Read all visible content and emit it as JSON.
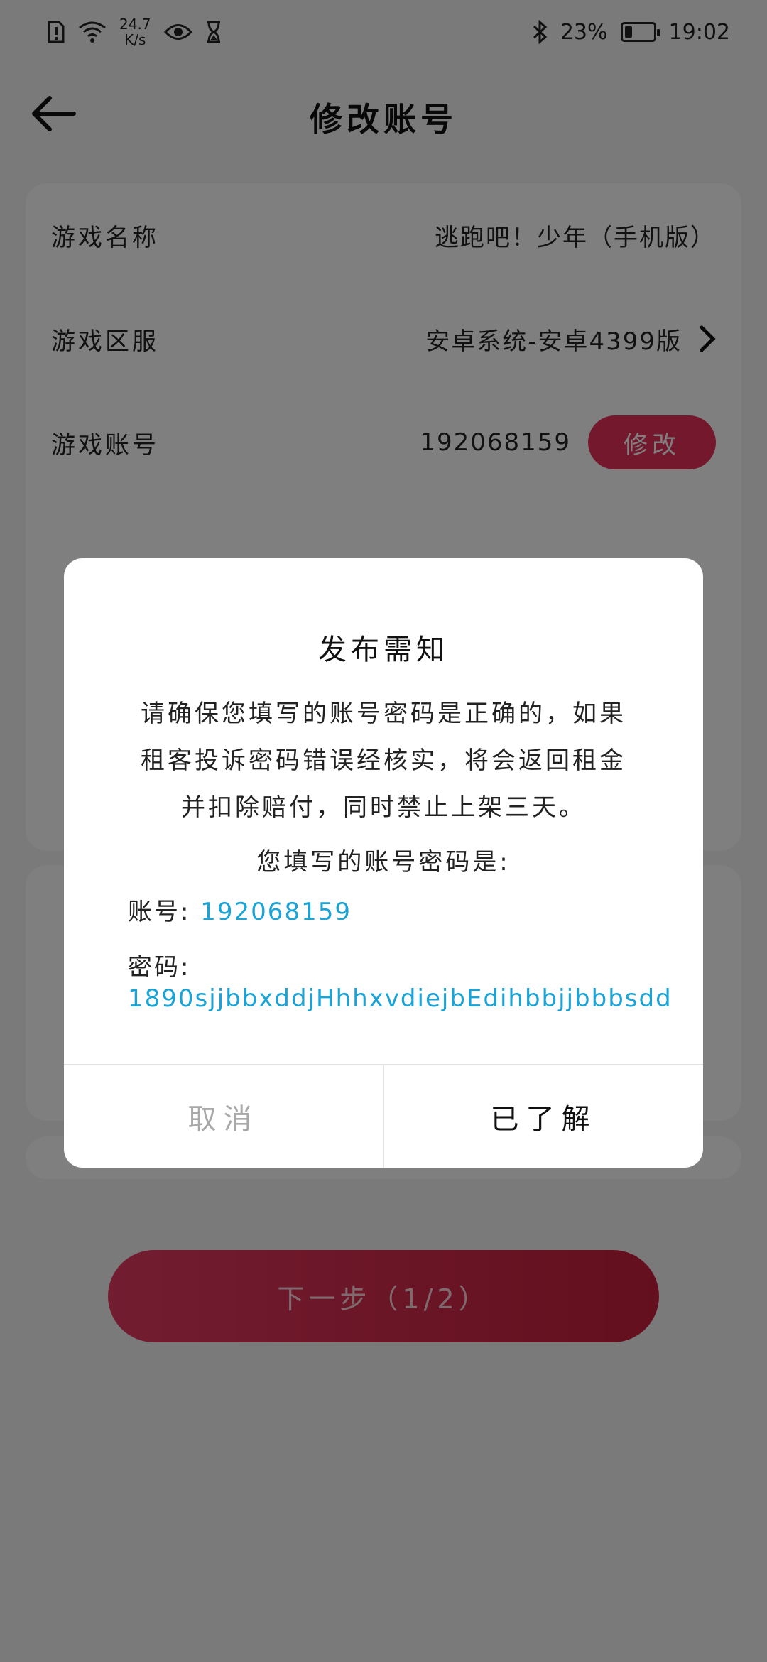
{
  "status_bar": {
    "net_speed_value": "24.7",
    "net_speed_unit": "K/s",
    "battery": "23%",
    "time": "19:02",
    "icons": [
      "sim-alert-icon",
      "wifi-icon",
      "eye-icon",
      "hourglass-icon",
      "bluetooth-icon",
      "battery-icon"
    ]
  },
  "header": {
    "title": "修改账号",
    "back_icon": "back-arrow-icon"
  },
  "form": {
    "game_name": {
      "label": "游戏名称",
      "value": "逃跑吧！少年（手机版）"
    },
    "game_server": {
      "label": "游戏区服",
      "value": "安卓系统-安卓4399版"
    },
    "game_account": {
      "label": "游戏账号",
      "value": "192068159",
      "button": "修改"
    }
  },
  "next_button": {
    "label": "下一步（1/2）"
  },
  "dialog": {
    "title": "发布需知",
    "body": "请确保您填写的账号密码是正确的，如果租客投诉密码错误经核实，将会返回租金并扣除赔付，同时禁止上架三天。",
    "subtitle": "您填写的账号密码是:",
    "account_label": "账号:",
    "account_value": "192068159",
    "password_label": "密码:",
    "password_value": "1890sjjbbxddjHhhxvdiejbEdihbbjjbbbsdd",
    "cancel_label": "取消",
    "confirm_label": "已了解"
  },
  "colors": {
    "accent": "#e8315a",
    "link_blue": "#1aa3d6"
  }
}
